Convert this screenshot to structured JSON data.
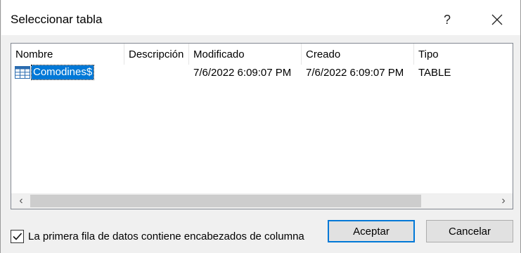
{
  "window": {
    "title": "Seleccionar tabla",
    "help_label": "?"
  },
  "table": {
    "columns": [
      "Nombre",
      "Descripción",
      "Modificado",
      "Creado",
      "Tipo"
    ],
    "rows": [
      {
        "name": "Comodines$",
        "description": "",
        "modified": "7/6/2022 6:09:07 PM",
        "created": "7/6/2022 6:09:07 PM",
        "type": "TABLE",
        "icon": "table-icon",
        "selected": true
      }
    ]
  },
  "scrollbar": {
    "left_arrow": "‹",
    "right_arrow": "›"
  },
  "options": {
    "header_checkbox_label": "La primera fila de datos contiene encabezados de columna",
    "header_checkbox_checked": true
  },
  "buttons": {
    "accept": "Aceptar",
    "cancel": "Cancelar"
  },
  "colors": {
    "selection": "#0078d7",
    "dialog_bg": "#f0f0f0",
    "primary_border": "#0078d7"
  }
}
